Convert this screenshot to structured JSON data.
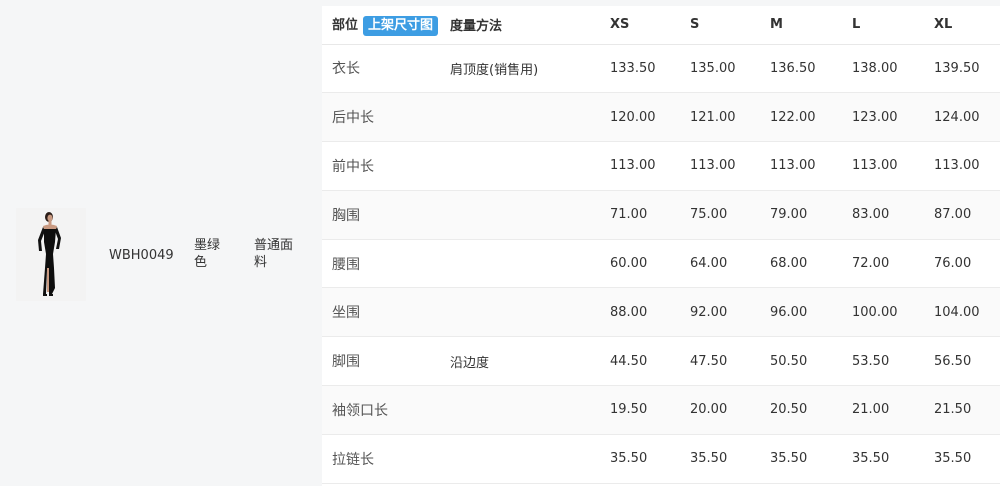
{
  "product": {
    "sku": "WBH0049",
    "color": "墨绿色",
    "fabric": "普通面料"
  },
  "table": {
    "header": {
      "part": "部位",
      "tag": "上架尺寸图",
      "method": "度量方法",
      "sizes": [
        "XS",
        "S",
        "M",
        "L",
        "XL"
      ]
    },
    "rows": [
      {
        "part": "衣长",
        "method": "肩顶度(销售用)",
        "values": [
          "133.50",
          "135.00",
          "136.50",
          "138.00",
          "139.50"
        ]
      },
      {
        "part": "后中长",
        "method": "",
        "values": [
          "120.00",
          "121.00",
          "122.00",
          "123.00",
          "124.00"
        ]
      },
      {
        "part": "前中长",
        "method": "",
        "values": [
          "113.00",
          "113.00",
          "113.00",
          "113.00",
          "113.00"
        ]
      },
      {
        "part": "胸围",
        "method": "",
        "values": [
          "71.00",
          "75.00",
          "79.00",
          "83.00",
          "87.00"
        ]
      },
      {
        "part": "腰围",
        "method": "",
        "values": [
          "60.00",
          "64.00",
          "68.00",
          "72.00",
          "76.00"
        ]
      },
      {
        "part": "坐围",
        "method": "",
        "values": [
          "88.00",
          "92.00",
          "96.00",
          "100.00",
          "104.00"
        ]
      },
      {
        "part": "脚围",
        "method": "沿边度",
        "values": [
          "44.50",
          "47.50",
          "50.50",
          "53.50",
          "56.50"
        ]
      },
      {
        "part": "袖领口长",
        "method": "",
        "values": [
          "19.50",
          "20.00",
          "20.50",
          "21.00",
          "21.50"
        ]
      },
      {
        "part": "拉链长",
        "method": "",
        "values": [
          "35.50",
          "35.50",
          "35.50",
          "35.50",
          "35.50"
        ]
      }
    ]
  }
}
